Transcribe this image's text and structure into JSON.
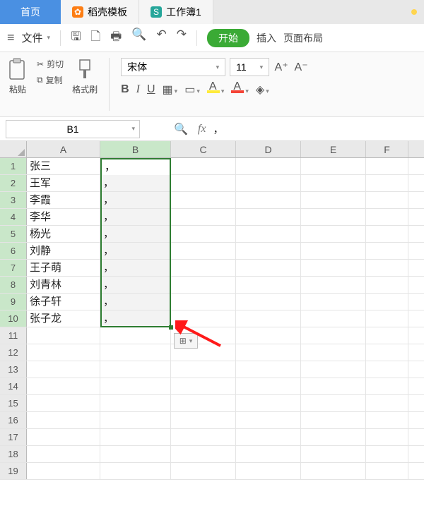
{
  "tabs": {
    "home": "首页",
    "templates": "稻壳模板",
    "workbook": "工作簿1"
  },
  "menu": {
    "file": "文件",
    "start": "开始",
    "insert": "插入",
    "page_layout": "页面布局"
  },
  "ribbon": {
    "paste": "粘贴",
    "cut": "剪切",
    "copy": "复制",
    "format_painter": "格式刷",
    "font_name": "宋体",
    "font_size": "11",
    "bold": "B",
    "italic": "I",
    "underline": "U",
    "font_bigger": "A⁺",
    "font_smaller": "A⁻",
    "highlight_letter": "A",
    "textcolor_letter": "A"
  },
  "namebox": "B1",
  "formula_value": "，",
  "columns": [
    "A",
    "B",
    "C",
    "D",
    "E",
    "F"
  ],
  "row_count": 19,
  "selected_rows": 10,
  "data": {
    "A": [
      "张三",
      "王军",
      "李霞",
      "李华",
      "杨光",
      "刘静",
      "王子萌",
      "刘青林",
      "徐子轩",
      "张子龙"
    ],
    "B": [
      "，",
      "，",
      "，",
      "，",
      "，",
      "，",
      "，",
      "，",
      "，",
      "，"
    ]
  },
  "paste_options_label": "⊞"
}
